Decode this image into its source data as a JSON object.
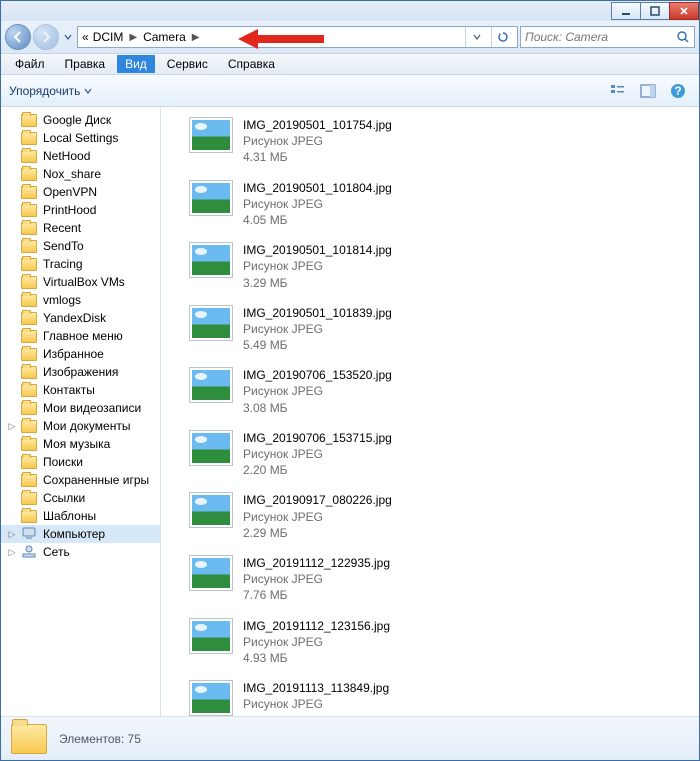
{
  "breadcrumb": {
    "parent": "DCIM",
    "current": "Camera"
  },
  "search": {
    "placeholder": "Поиск: Camera"
  },
  "menu": {
    "file": "Файл",
    "edit": "Правка",
    "view": "Вид",
    "service": "Сервис",
    "help": "Справка"
  },
  "toolbar": {
    "organize": "Упорядочить"
  },
  "tree": [
    {
      "label": "Google Диск",
      "icon": "folder"
    },
    {
      "label": "Local Settings",
      "icon": "folder"
    },
    {
      "label": "NetHood",
      "icon": "folder"
    },
    {
      "label": "Nox_share",
      "icon": "folder"
    },
    {
      "label": "OpenVPN",
      "icon": "folder"
    },
    {
      "label": "PrintHood",
      "icon": "folder"
    },
    {
      "label": "Recent",
      "icon": "folder"
    },
    {
      "label": "SendTo",
      "icon": "folder"
    },
    {
      "label": "Tracing",
      "icon": "folder"
    },
    {
      "label": "VirtualBox VMs",
      "icon": "folder"
    },
    {
      "label": "vmlogs",
      "icon": "folder"
    },
    {
      "label": "YandexDisk",
      "icon": "folder"
    },
    {
      "label": "Главное меню",
      "icon": "folder"
    },
    {
      "label": "Избранное",
      "icon": "folder"
    },
    {
      "label": "Изображения",
      "icon": "folder"
    },
    {
      "label": "Контакты",
      "icon": "folder"
    },
    {
      "label": "Мои видеозаписи",
      "icon": "folder"
    },
    {
      "label": "Мои документы",
      "icon": "folder",
      "exp": true
    },
    {
      "label": "Моя музыка",
      "icon": "folder"
    },
    {
      "label": "Поиски",
      "icon": "folder"
    },
    {
      "label": "Сохраненные игры",
      "icon": "folder"
    },
    {
      "label": "Ссылки",
      "icon": "folder"
    },
    {
      "label": "Шаблоны",
      "icon": "folder"
    },
    {
      "label": "Компьютер",
      "icon": "computer",
      "sel": true,
      "exp": true
    },
    {
      "label": "Сеть",
      "icon": "network",
      "exp": true
    }
  ],
  "file_type_label": "Рисунок JPEG",
  "files": [
    {
      "name": "IMG_20190501_101754.jpg",
      "size": "4.31 МБ"
    },
    {
      "name": "IMG_20190501_101804.jpg",
      "size": "4.05 МБ"
    },
    {
      "name": "IMG_20190501_101814.jpg",
      "size": "3.29 МБ"
    },
    {
      "name": "IMG_20190501_101839.jpg",
      "size": "5.49 МБ"
    },
    {
      "name": "IMG_20190706_153520.jpg",
      "size": "3.08 МБ"
    },
    {
      "name": "IMG_20190706_153715.jpg",
      "size": "2.20 МБ"
    },
    {
      "name": "IMG_20190917_080226.jpg",
      "size": "2.29 МБ"
    },
    {
      "name": "IMG_20191112_122935.jpg",
      "size": "7.76 МБ"
    },
    {
      "name": "IMG_20191112_123156.jpg",
      "size": "4.93 МБ"
    },
    {
      "name": "IMG_20191113_113849.jpg",
      "size": ""
    }
  ],
  "status": {
    "label": "Элементов:",
    "count": "75"
  }
}
